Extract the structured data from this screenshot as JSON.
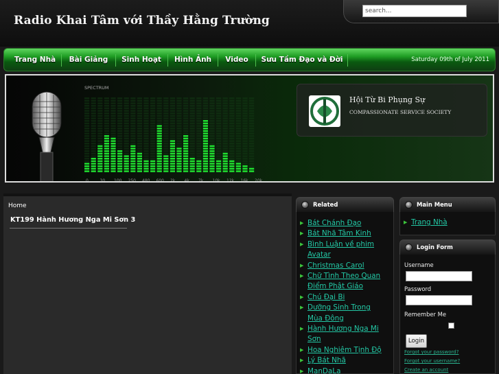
{
  "header": {
    "site_title": "Radio Khai Tâm với Thầy Hằng Trường",
    "search_placeholder": "search..."
  },
  "nav": {
    "items": [
      "Trang Nhà",
      "Bài Giảng",
      "Sinh Hoạt",
      "Hình Ảnh",
      "Video",
      "Sưu Tầm Đạo và Đời"
    ],
    "date": "Saturday 09th of July 2011"
  },
  "banner": {
    "org_name": "Hội Từ Bi Phụng Sự",
    "org_subtitle": "COMPASSIONATE SERVICE SOCIETY",
    "spectrum_label": "SPECTRUM",
    "freq_labels": [
      "0",
      "30",
      "100",
      "250",
      "480",
      "600",
      "2k",
      "4k",
      "7k",
      "10k",
      "12k",
      "16k",
      "20k"
    ],
    "levels": [
      0.12,
      0.2,
      0.38,
      0.5,
      0.45,
      0.3,
      0.22,
      0.35,
      0.25,
      0.18,
      0.15,
      0.62,
      0.22,
      0.42,
      0.33,
      0.5,
      0.2,
      0.15,
      0.7,
      0.35,
      0.15,
      0.28,
      0.18,
      0.12,
      0.1,
      0.08
    ],
    "accent": "#22ee33"
  },
  "main": {
    "breadcrumb": "Home",
    "article_title": "KT199 Hành Hương Nga Mi Sơn 3"
  },
  "related": {
    "title": "Related",
    "links": [
      [
        "Bát Chánh Đạo"
      ],
      [
        "Bát Nhã Tâm Kinh"
      ],
      [
        "Bình Luận về phim",
        "Avatar"
      ],
      [
        "Christmas Carol"
      ],
      [
        "Chữ Tình Theo Quan",
        "Điểm Phật Giáo"
      ],
      [
        "Chú Đại Bi"
      ],
      [
        "Dưỡng Sinh Trong",
        "Mùa Đông"
      ],
      [
        "Hành Hương Nga Mi",
        "Sơn"
      ],
      [
        "Hoa Nghiêm Tịnh Độ"
      ],
      [
        "Lý Bát Nhã"
      ],
      [
        "ManDaLa"
      ]
    ]
  },
  "main_menu": {
    "title": "Main Menu",
    "items": [
      "Trang Nhà"
    ]
  },
  "login": {
    "title": "Login Form",
    "username_label": "Username",
    "password_label": "Password",
    "remember_label": "Remember Me",
    "button": "Login",
    "forgot_password": "Forgot your password?",
    "forgot_username": "Forgot your username?",
    "create_account": "Create an account"
  }
}
